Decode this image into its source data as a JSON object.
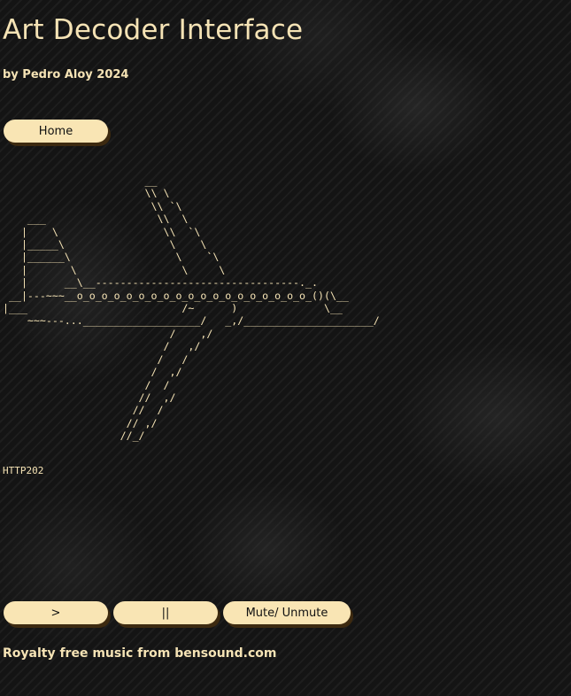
{
  "header": {
    "title": "Art Decoder Interface",
    "subtitle": "by Pedro Aloy 2024"
  },
  "nav": {
    "home_label": "Home"
  },
  "art": {
    "ascii": "                       __\n                       \\\\ \\\n                        \\\\ `\\\n    ___                  \\\\  \\\n   |    \\                 \\\\  `\\\n   |_____\\                 \\    \\\n   |______\\                 \\    `\\\n   |       \\                 \\     \\\n   |      __\\__---------------------------------._.\n __|---~~~__o_o_o_o_o_o_o_o_o_o_o_o_o_o_o_o_o_o_o_()(\\__\n|___                         /~      )              \\__\n    ~~~---...___________________/   _,/_____________________/\n                           /    ,/\n                          /   ,/\n                         /   /\n                        /  ,/\n                       /  /\n                      //  ,/\n                     //  /\n                    // ,/\n                   //_/",
    "source_label": "HTTP202"
  },
  "player": {
    "play_label": ">",
    "pause_label": "||",
    "mute_label": "Mute/ Unmute"
  },
  "footer": {
    "credit": "Royalty free music from bensound.com"
  }
}
